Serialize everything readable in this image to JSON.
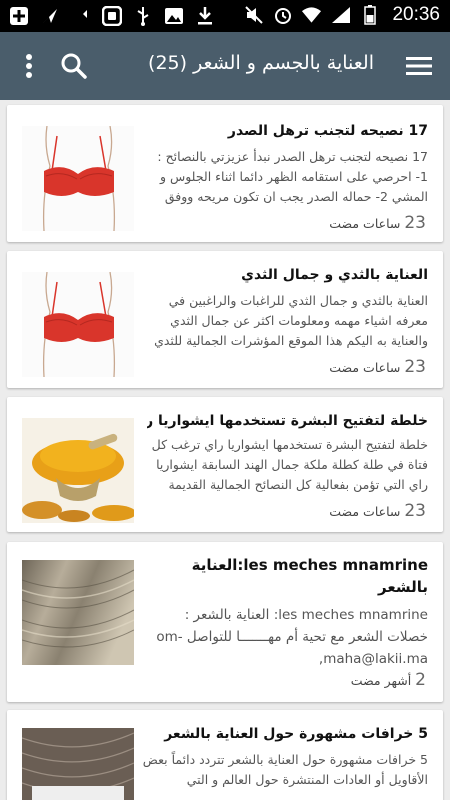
{
  "status_bar": {
    "time": "20:36",
    "icons": [
      "add-icon",
      "send-icon",
      "cursor-icon",
      "bbm-icon",
      "usb-icon",
      "image-icon",
      "download-icon",
      "mute-icon",
      "alarm-icon",
      "wifi-icon",
      "signal-icon",
      "battery-icon"
    ]
  },
  "app_bar": {
    "title": "العناية بالجسم و الشعر (25)",
    "icons": [
      "hamburger-menu-icon",
      "search-icon",
      "overflow-menu-icon"
    ]
  },
  "articles": [
    {
      "title": "17 نصيحه لتجنب ترهل الصدر",
      "excerpt": "17 نصيحه لتجنب ترهل الصدر نبدأ عزيزتي بالنصائح : 1- احرصي على استقامه الظهر دائما اثناء الجلوس و المشي 2- حماله الصدر يجب ان تكون مريحه ووفق",
      "time_num": "23",
      "time_unit": "ساعات مضت",
      "thumb": "bra-illustration"
    },
    {
      "title": "العناية بالثدي و جمال الثدي",
      "excerpt": "العناية بالثدي و جمال الثدي للراغبات والراغبين في معرفه اشياء مهمه ومعلومات اكثر عن جمال الثدي والعناية به اليكم هذا الموقع المؤشرات الجمالية للثدي",
      "time_num": "23",
      "time_unit": "ساعات مضت",
      "thumb": "bra-illustration"
    },
    {
      "title": "خلطة لتفتيح البشرة تستخدمها ايشواريا راي",
      "excerpt": "خلطة لتفتيح البشرة تستخدمها ايشواريا راي ترغب كل فتاة في طلة كطلة ملكة جمال الهند السابقة ايشواريا راي التي تؤمن بفعالية كل النصائح الجمالية القديمة",
      "time_num": "23",
      "time_unit": "ساعات مضت",
      "thumb": "turmeric-photo"
    },
    {
      "title": "les meches mnamrine:العناية بالشعر",
      "excerpt": "les meches mnamrine: العناية بالشعر : خصلات الشعر مع تحية أم مهـــــــا للتواصل om-maha@lakii.ma,",
      "time_num": "2",
      "time_unit": "أشهر مضت",
      "thumb": "hair-photo"
    },
    {
      "title": "5 خرافات مشهورة حول العناية بالشعر",
      "excerpt": "5 خرافات مشهورة حول العناية بالشعر تتردد دائماً بعض الأقاويل أو العادات المنتشرة حول العالم و التي",
      "time_num": "",
      "time_unit": "",
      "thumb": "hair-comb-photo"
    }
  ],
  "colors": {
    "app_bar": "#4a5d6b",
    "background": "#ececec",
    "card": "#ffffff",
    "bra_red": "#d9352b"
  }
}
